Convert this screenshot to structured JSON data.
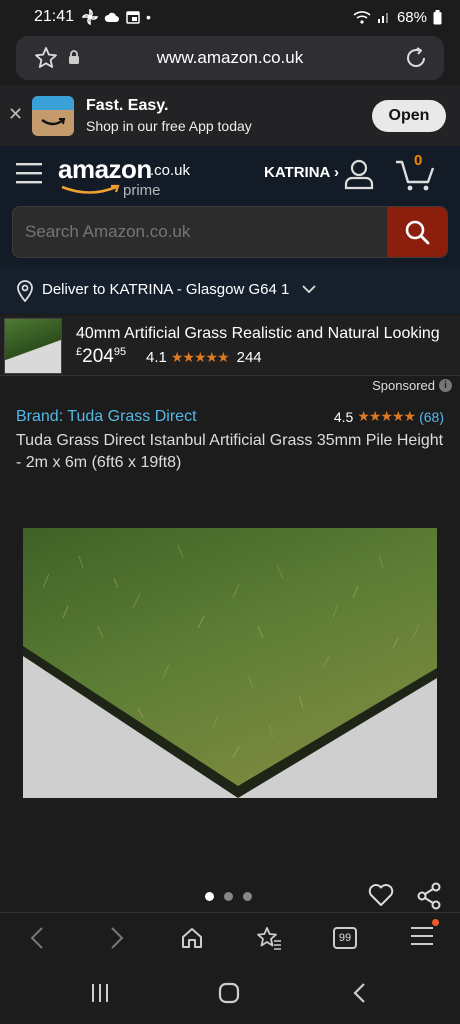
{
  "status": {
    "time": "21:41",
    "battery": "68%"
  },
  "browser": {
    "url": "www.amazon.co.uk"
  },
  "app_banner": {
    "headline": "Fast. Easy.",
    "subline": "Shop in our free App today",
    "open_label": "Open"
  },
  "header": {
    "logo_word": "amazon",
    "logo_tld": ".co.uk",
    "logo_prime": "prime",
    "user_label": "KATRINA ›",
    "cart_count": "0"
  },
  "search": {
    "placeholder": "Search Amazon.co.uk"
  },
  "deliver": {
    "text": "Deliver to KATRINA - Glasgow G64 1"
  },
  "sponsored_ad": {
    "title": "40mm Artificial Grass Realistic and Natural Looking",
    "price_currency": "£",
    "price_whole": "204",
    "price_fraction": "95",
    "rating": "4.1",
    "stars": "★★★★★",
    "rating_count": "244"
  },
  "sponsored_label": "Sponsored",
  "product": {
    "brand_link": "Brand: Tuda Grass Direct",
    "rating": "4.5",
    "stars": "★★★★★",
    "rating_count": "(68)",
    "title": "Tuda Grass Direct Istanbul Artificial Grass 35mm Pile Height - 2m x 6m (6ft6 x 19ft8)",
    "image_count": 3,
    "image_index": 1
  },
  "toolbar": {
    "tab_count": "99"
  }
}
